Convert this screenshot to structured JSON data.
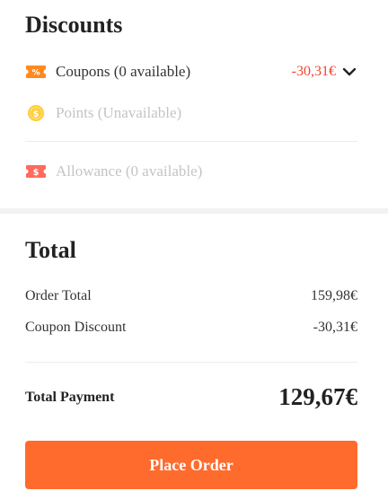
{
  "discounts": {
    "title": "Discounts",
    "coupons": {
      "label": "Coupons (0 available)",
      "amount": "-30,31€",
      "icon": "coupon-percent-icon",
      "icon_color": "#ff8a1f",
      "amount_color": "#f0442f"
    },
    "points": {
      "label": "Points (Unavailable)",
      "icon": "points-coin-icon",
      "icon_color": "#ffcc33"
    },
    "allowance": {
      "label": "Allowance (0 available)",
      "icon": "allowance-dollar-icon",
      "icon_color": "#ff5a4f"
    }
  },
  "total": {
    "title": "Total",
    "order_total_label": "Order Total",
    "order_total_value": "159,98€",
    "coupon_discount_label": "Coupon Discount",
    "coupon_discount_value": "-30,31€",
    "payment_label": "Total Payment",
    "payment_value": "129,67€"
  },
  "actions": {
    "place_order_label": "Place Order",
    "button_color": "#ff6b2c"
  }
}
